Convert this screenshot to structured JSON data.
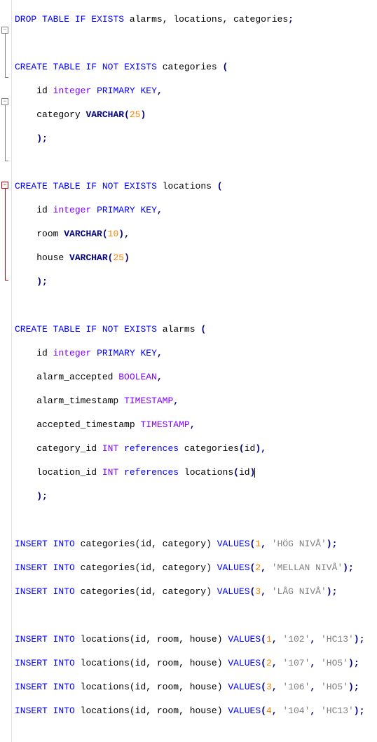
{
  "sql": {
    "drop_stmt": {
      "kw1": "DROP",
      "kw2": "TABLE",
      "kw3": "IF",
      "kw4": "EXISTS",
      "idents": "alarms, locations, categories",
      "semi": ";"
    },
    "create_categories": {
      "kw1": "CREATE",
      "kw2": "TABLE",
      "kw3": "IF",
      "kw4": "NOT",
      "kw5": "EXISTS",
      "name": "categories",
      "open": "(",
      "col1": {
        "name": "id",
        "type": "integer",
        "constr": "PRIMARY KEY",
        "comma": ","
      },
      "col2": {
        "name": "category",
        "type": "VARCHAR",
        "len": "25",
        "open": "(",
        "close": ")"
      },
      "close": ")",
      "semi": ";"
    },
    "create_locations": {
      "kw1": "CREATE",
      "kw2": "TABLE",
      "kw3": "IF",
      "kw4": "NOT",
      "kw5": "EXISTS",
      "name": "locations",
      "open": "(",
      "col1": {
        "name": "id",
        "type": "integer",
        "constr": "PRIMARY KEY",
        "comma": ","
      },
      "col2": {
        "name": "room",
        "type": "VARCHAR",
        "len": "10",
        "open": "(",
        "close": ")",
        "comma": ","
      },
      "col3": {
        "name": "house",
        "type": "VARCHAR",
        "len": "25",
        "open": "(",
        "close": ")"
      },
      "close": ")",
      "semi": ";"
    },
    "create_alarms": {
      "kw1": "CREATE",
      "kw2": "TABLE",
      "kw3": "IF",
      "kw4": "NOT",
      "kw5": "EXISTS",
      "name": "alarms",
      "open": "(",
      "col1": {
        "name": "id",
        "type": "integer",
        "constr": "PRIMARY KEY",
        "comma": ","
      },
      "col2": {
        "name": "alarm_accepted",
        "type": "BOOLEAN",
        "comma": ","
      },
      "col3": {
        "name": "alarm_timestamp",
        "type": "TIMESTAMP",
        "comma": ","
      },
      "col4": {
        "name": "accepted_timestamp",
        "type": "TIMESTAMP",
        "comma": ","
      },
      "col5": {
        "name": "category_id",
        "type": "INT",
        "refkw": "references",
        "reft": "categories",
        "refc": "id",
        "open": "(",
        "close": ")",
        "comma": ","
      },
      "col6": {
        "name": "location_id",
        "type": "INT",
        "refkw": "references",
        "reft": "locations",
        "refc": "id",
        "open": "(",
        "close": ")"
      },
      "close": ")",
      "semi": ";"
    },
    "insert_categories": [
      {
        "id": "1",
        "val": "'HÖG NIVÅ'"
      },
      {
        "id": "2",
        "val": "'MELLAN NIVÅ'"
      },
      {
        "id": "3",
        "val": "'LÅG NIVÅ'"
      }
    ],
    "insert_cat_common": {
      "kw1": "INSERT",
      "kw2": "INTO",
      "table": "categories",
      "cols": "(id, category)",
      "kw3": "VALUES",
      "open": "(",
      "sep": ", ",
      "close": ")",
      "semi": ";"
    },
    "insert_locations": [
      {
        "id": "1",
        "room": "'102'",
        "house": "'HC13'"
      },
      {
        "id": "2",
        "room": "'107'",
        "house": "'HO5'"
      },
      {
        "id": "3",
        "room": "'106'",
        "house": "'HO5'"
      },
      {
        "id": "4",
        "room": "'104'",
        "house": "'HC13'"
      }
    ],
    "insert_loc_common": {
      "kw1": "INSERT",
      "kw2": "INTO",
      "table": "locations",
      "cols": "(id, room, house)",
      "kw3": "VALUES",
      "open": "(",
      "sep": ", ",
      "close": ")",
      "semi": ";"
    }
  }
}
